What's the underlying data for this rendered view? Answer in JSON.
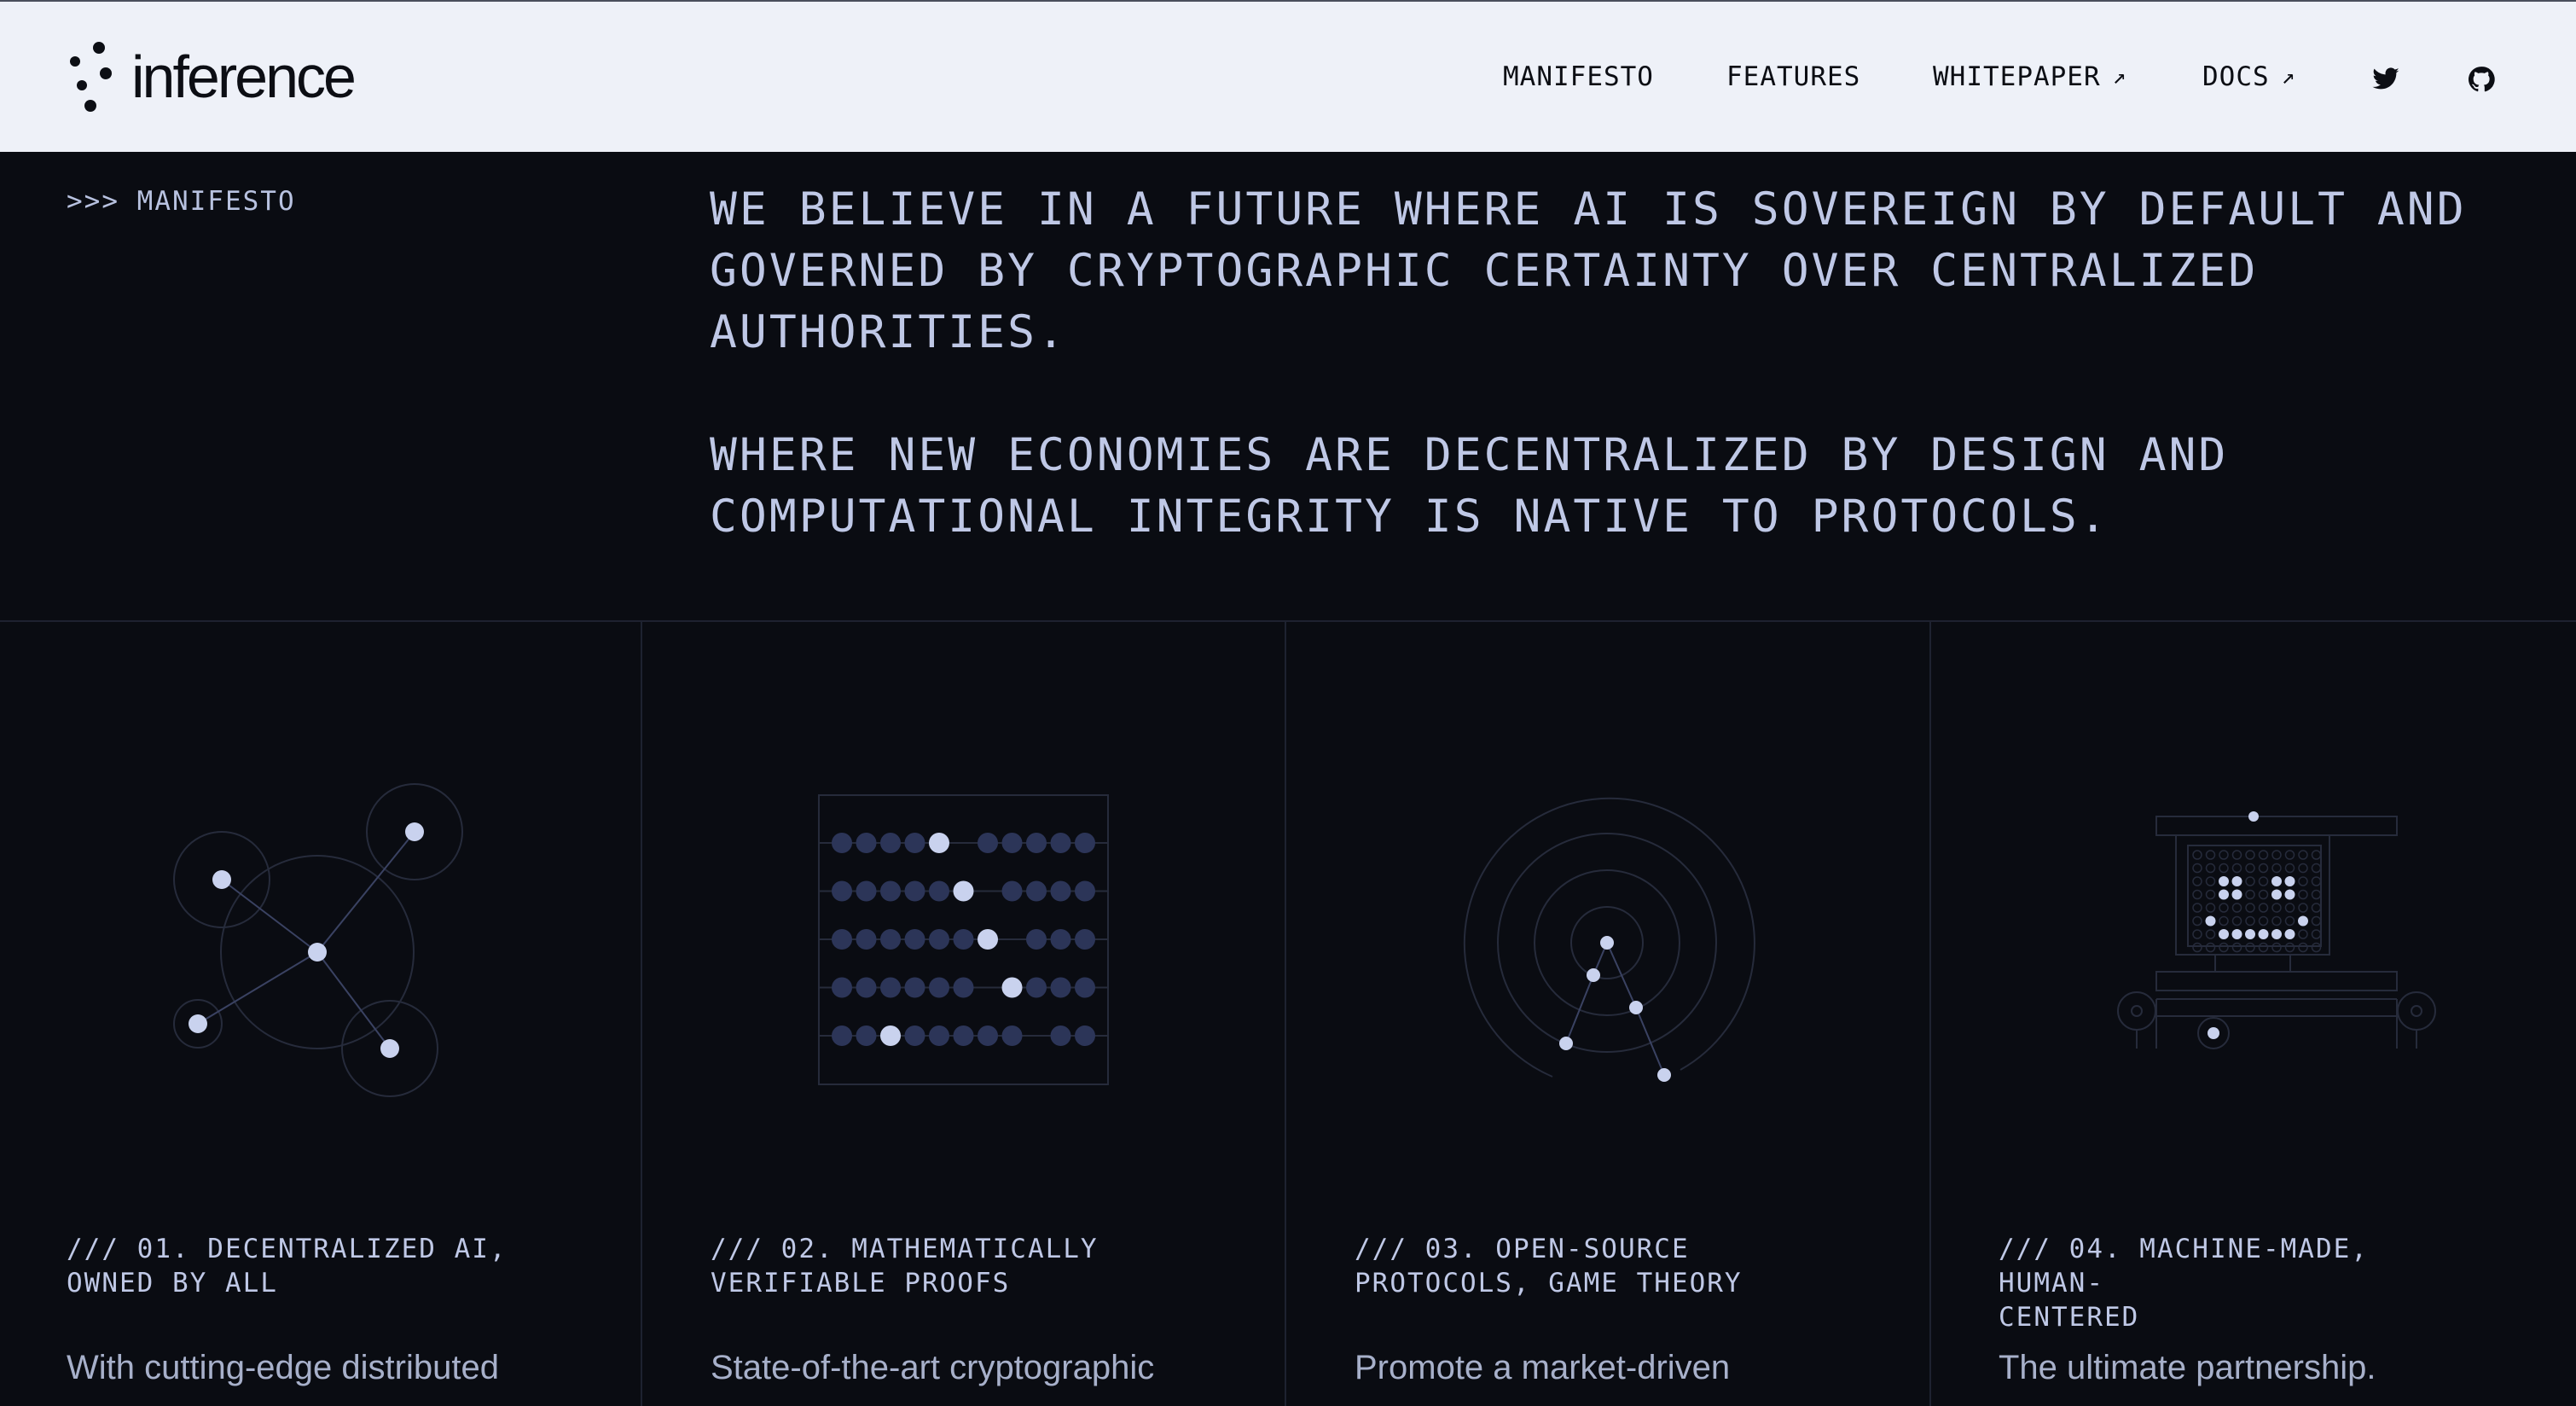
{
  "brand": {
    "name": "inference"
  },
  "nav": {
    "items": [
      {
        "label": "MANIFESTO",
        "external": false
      },
      {
        "label": "FEATURES",
        "external": false
      },
      {
        "label": "WHITEPAPER",
        "external": true
      },
      {
        "label": "DOCS",
        "external": true
      }
    ],
    "external_glyph": "↗",
    "social": [
      "twitter-icon",
      "github-icon"
    ]
  },
  "manifesto": {
    "breadcrumb": ">>> MANIFESTO",
    "paragraphs": [
      "WE BELIEVE IN A FUTURE WHERE AI IS SOVEREIGN BY DEFAULT AND GOVERNED BY CRYPTOGRAPHIC CERTAINTY OVER CENTRALIZED AUTHORITIES.",
      "WHERE NEW ECONOMIES ARE DECENTRALIZED BY DESIGN AND COMPUTATIONAL INTEGRITY IS NATIVE TO PROTOCOLS."
    ]
  },
  "features": [
    {
      "title": "/// 01. DECENTRALIZED AI,\nOWNED BY ALL",
      "description": "With cutting-edge distributed",
      "icon": "network-nodes-icon"
    },
    {
      "title": "/// 02. MATHEMATICALLY\nVERIFIABLE PROOFS",
      "description": "State-of-the-art cryptographic",
      "icon": "abacus-icon"
    },
    {
      "title": "/// 03. OPEN-SOURCE\nPROTOCOLS, GAME THEORY",
      "description": "Promote a market-driven",
      "icon": "radar-rings-icon"
    },
    {
      "title": "/// 04. MACHINE-MADE, HUMAN-\nCENTERED",
      "description": "The ultimate partnership.",
      "icon": "robot-cart-icon"
    }
  ],
  "colors": {
    "background": "#0a0c12",
    "header_bg": "#eef1f8",
    "text": "#bfc8e6",
    "accent_dot": "#c9d2ee",
    "bead": "#2c3558",
    "line": "#262b3b"
  }
}
